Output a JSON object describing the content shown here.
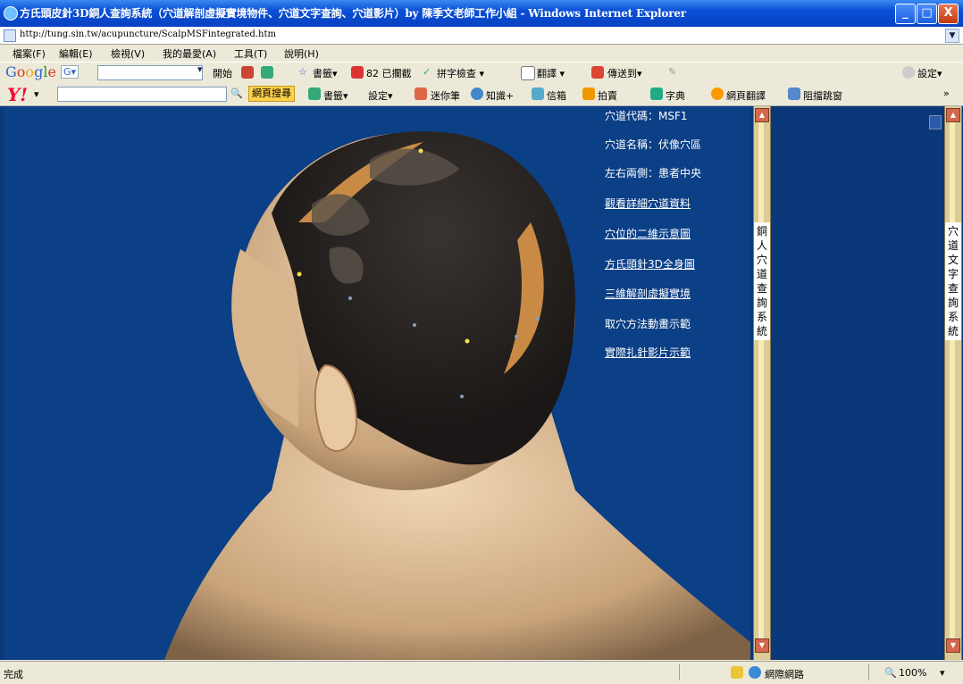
{
  "window": {
    "title": "方氏頭皮針3D銅人查詢系統（穴道解剖虛擬實境物件、穴道文字查詢、穴道影片）by 陳季文老師工作小組 - Windows Internet Explorer",
    "min": "_",
    "max": "□",
    "close": "X"
  },
  "address": {
    "url": "http://tung.sin.tw/acupuncture/ScalpMSFintegrated.htm"
  },
  "menu": {
    "items": [
      "檔案(F)",
      "編輯(E)",
      "檢視(V)",
      "我的最愛(A)",
      "工具(T)",
      "說明(H)"
    ]
  },
  "google_bar": {
    "logo": "Google",
    "g_button": "G▾",
    "start": "開始",
    "bookmarks": "書籤▾",
    "blocked": "82 已攔截",
    "spellcheck": "拼字檢查 ▾",
    "translate": "翻譯 ▾",
    "sendto": "傳送到▾",
    "settings": "設定▾"
  },
  "yahoo_bar": {
    "logo": "Y!",
    "search_button": "網頁搜尋",
    "bookmarks": "書籤▾",
    "settings": "設定▾",
    "mini": "迷你筆",
    "knowledge": "知識+",
    "mail": "信箱",
    "auction": "拍賣",
    "dict": "字典",
    "webtrans": "網頁翻譯",
    "popup": "阻擋跳窗",
    "more": "»"
  },
  "info": {
    "code": "穴道代碼：MSF1",
    "name": "穴道名稱：伏像穴區",
    "side": "左右兩側：患者中央",
    "detail_link": "觀看詳細穴道資料",
    "twod_link": "穴位的二維示意圖",
    "full3d_link": "方氏頭針3D全身圖",
    "vr_link": "三維解剖虛擬實境",
    "anim_text": "取穴方法動畫示範",
    "video_link": "實際扎針影片示範"
  },
  "sidebars": {
    "left_label": "銅人穴道查詢系統",
    "right_label": "穴道文字查詢系統"
  },
  "status": {
    "done": "完成",
    "zone": "網際網路",
    "zoom": "100%"
  },
  "colors": {
    "title_blue": "#0a4fd6",
    "scene_bg": "#0b3f86",
    "scroll_tan": "#dccb97",
    "cap_red": "#d4674e"
  }
}
